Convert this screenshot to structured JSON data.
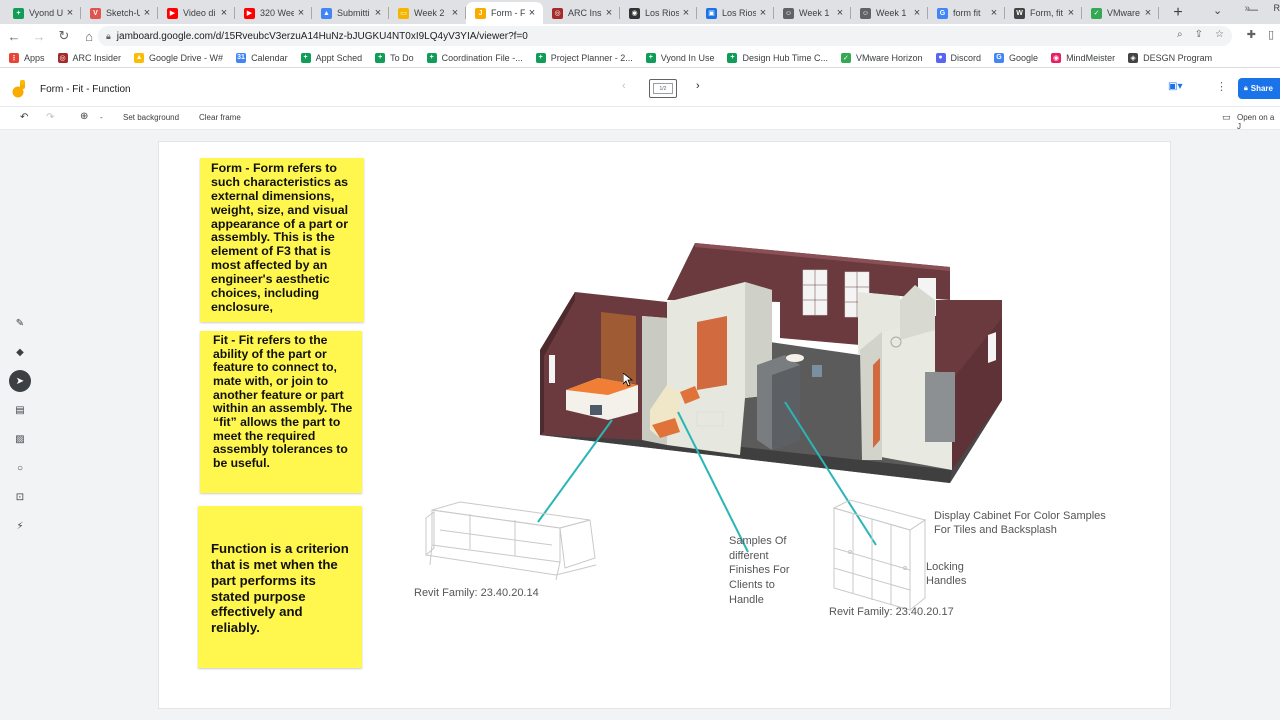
{
  "browser": {
    "tabs": [
      {
        "label": "Vyond U",
        "fav_color": "#0f9d58",
        "fav_glyph": "+"
      },
      {
        "label": "Sketch-U",
        "fav_color": "#e2524f",
        "fav_glyph": "V"
      },
      {
        "label": "Video di",
        "fav_color": "#ff0000",
        "fav_glyph": "▶"
      },
      {
        "label": "320 Wee",
        "fav_color": "#ff0000",
        "fav_glyph": "▶"
      },
      {
        "label": "Submitti",
        "fav_color": "#4285f4",
        "fav_glyph": "▲"
      },
      {
        "label": "Week 2",
        "fav_color": "#f4b400",
        "fav_glyph": "▭"
      },
      {
        "label": "Form - F",
        "fav_color": "#f9ab00",
        "fav_glyph": "J"
      },
      {
        "label": "ARC Insi",
        "fav_color": "#a52a2a",
        "fav_glyph": "◎"
      },
      {
        "label": "Los Rios",
        "fav_color": "#333333",
        "fav_glyph": "◉"
      },
      {
        "label": "Los Rios",
        "fav_color": "#1a73e8",
        "fav_glyph": "▣"
      },
      {
        "label": "Week 1",
        "fav_color": "#5f6368",
        "fav_glyph": "☺"
      },
      {
        "label": "Week 1",
        "fav_color": "#5f6368",
        "fav_glyph": "☺"
      },
      {
        "label": "form fit",
        "fav_color": "#4285f4",
        "fav_glyph": "G"
      },
      {
        "label": "Form, fit",
        "fav_color": "#444444",
        "fav_glyph": "W"
      },
      {
        "label": "VMware",
        "fav_color": "#34a853",
        "fav_glyph": "✓"
      }
    ],
    "active_tab": 6,
    "url": "jamboard.google.com/d/15RveubcV3erzuA14HuNz-bJUGKU4NT0xI9LQ4yV3YIA/viewer?f=0",
    "bookmarks": [
      {
        "label": "Apps",
        "color": "#ea4335",
        "glyph": "⋮"
      },
      {
        "label": "ARC Insider",
        "color": "#a52a2a",
        "glyph": "◎"
      },
      {
        "label": "Google Drive - W#",
        "color": "#fbbc04",
        "glyph": "▲"
      },
      {
        "label": "Calendar",
        "color": "#4285f4",
        "glyph": "31"
      },
      {
        "label": "Appt Sched",
        "color": "#0f9d58",
        "glyph": "+"
      },
      {
        "label": "To Do",
        "color": "#0f9d58",
        "glyph": "+"
      },
      {
        "label": "Coordination File -...",
        "color": "#0f9d58",
        "glyph": "+"
      },
      {
        "label": "Project Planner - 2...",
        "color": "#0f9d58",
        "glyph": "+"
      },
      {
        "label": "Vyond In Use",
        "color": "#0f9d58",
        "glyph": "+"
      },
      {
        "label": "Design Hub Time C...",
        "color": "#0f9d58",
        "glyph": "+"
      },
      {
        "label": "VMware Horizon",
        "color": "#34a853",
        "glyph": "✓"
      },
      {
        "label": "Discord",
        "color": "#5865f2",
        "glyph": "●"
      },
      {
        "label": "Google",
        "color": "#4285f4",
        "glyph": "G"
      },
      {
        "label": "MindMeister",
        "color": "#e91e63",
        "glyph": "◉"
      },
      {
        "label": "DESGN Program",
        "color": "#444444",
        "glyph": "◈"
      }
    ],
    "bookmark_overflow": "»",
    "bookmark_last": "R"
  },
  "app": {
    "title": "Form - Fit - Function",
    "frame_indicator": "1/2",
    "share_label": "Share",
    "toolbar": {
      "set_background": "Set background",
      "clear_frame": "Clear frame",
      "open_on": "Open on a J"
    }
  },
  "stickies": {
    "form": "Form - Form refers to such characteristics as external dimensions, weight, size, and visual appearance of a part or assembly. This is the element of F3 that is most affected by an engineer's aesthetic choices, including enclosure,",
    "fit": "Fit - Fit refers to the ability of the part or feature to connect to, mate with, or join to another feature or part within an assembly. The “fit” allows the part to meet the required assembly tolerances to be useful.",
    "function": "Function is a criterion that is met when the part performs its stated purpose effectively and reliably."
  },
  "labels": {
    "revit_sofa": "Revit Family:  23.40.20.14",
    "samples": [
      "Samples Of",
      "different",
      "Finishes For",
      "Clients to",
      "Handle"
    ],
    "display_cabinet": [
      "Display Cabinet For Color Samples",
      "For Tiles and Backsplash"
    ],
    "locking": [
      "Locking",
      "Handles"
    ],
    "revit_cabinet": "Revit Family: 23.40.20.17"
  },
  "colors": {
    "sticky": "#fff74d",
    "leader": "#2bb6b6",
    "brick": "#6b3a3f",
    "floor": "#5a5a5a",
    "share": "#1a73e8"
  }
}
